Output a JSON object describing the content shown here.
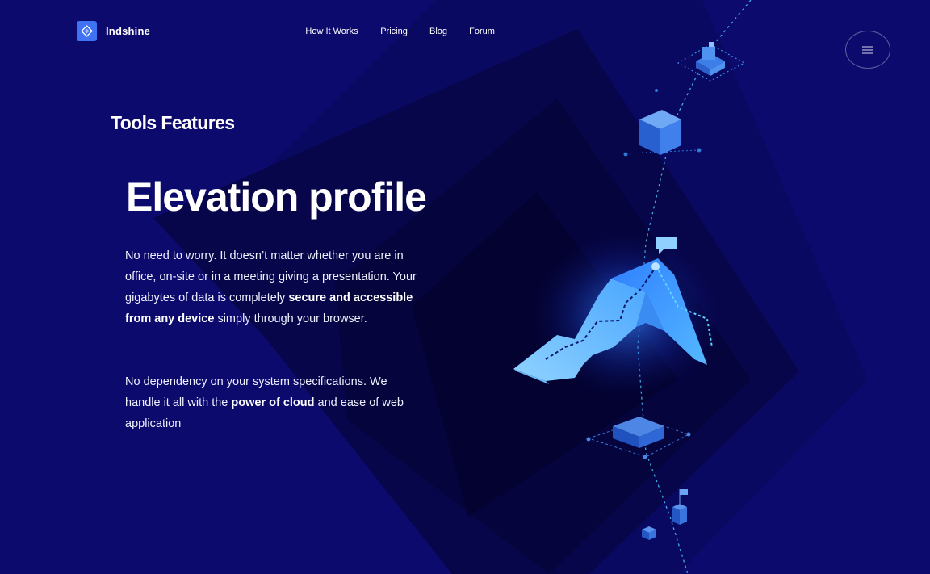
{
  "brand": {
    "name": "Indshine",
    "logo_icon": "diamond-logo-icon",
    "accent_color": "#3f72f5"
  },
  "nav": {
    "items": [
      {
        "label": "How It Works"
      },
      {
        "label": "Pricing"
      },
      {
        "label": "Blog"
      },
      {
        "label": "Forum"
      }
    ]
  },
  "menu_button": {
    "icon": "hamburger-icon"
  },
  "content": {
    "section_label": "Tools Features",
    "title": "Elevation profile",
    "paragraph_1": {
      "part_1": "No need to worry. It doesn’t matter whether you are in office, on-site or in a meeting giving a presentation. Your gigabytes of data is completely ",
      "bold_1": "secure and accessible from any device",
      "part_2": " simply through your browser."
    },
    "paragraph_2": {
      "part_1": "No dependency on your system specifications. We handle it all with the ",
      "bold_1": "power of cloud",
      "part_2": " and ease of web application"
    }
  },
  "colors": {
    "background": "#0d0a6e",
    "dark_shape": "#07064a",
    "darker_shape": "#040335",
    "accent_cyan": "#5fd3ff"
  }
}
